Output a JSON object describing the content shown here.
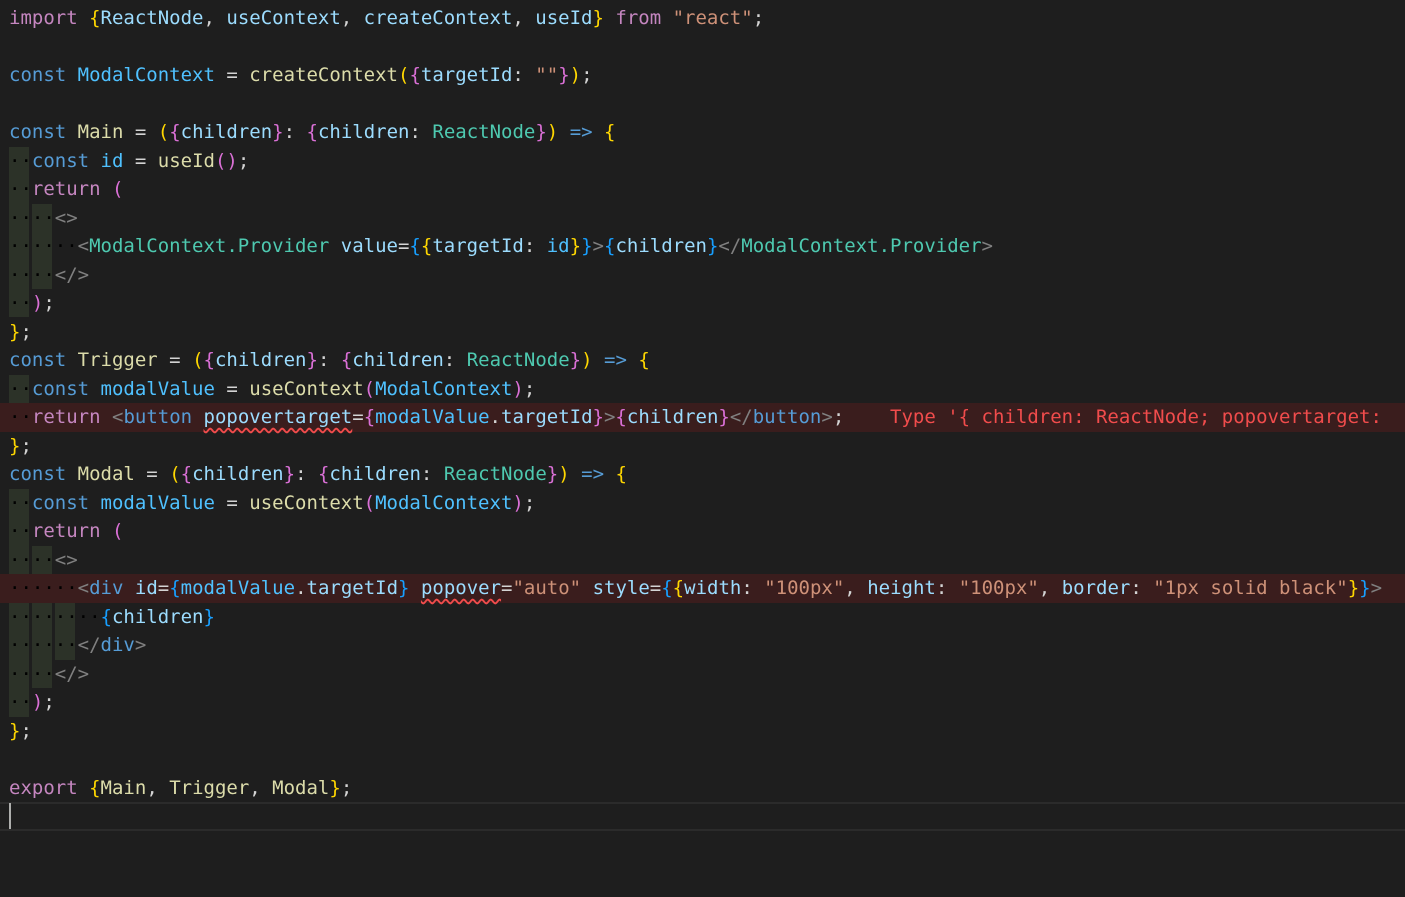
{
  "editor": {
    "language": "tsx",
    "cursor_line": 29,
    "lines": [
      {
        "n": 1,
        "tokens": [
          [
            "import",
            "kw"
          ],
          [
            " ",
            "ws"
          ],
          [
            "{",
            "b1"
          ],
          [
            "ReactNode",
            "var"
          ],
          [
            ", ",
            "punct"
          ],
          [
            "useContext",
            "var"
          ],
          [
            ", ",
            "punct"
          ],
          [
            "createContext",
            "var"
          ],
          [
            ", ",
            "punct"
          ],
          [
            "useId",
            "var"
          ],
          [
            "}",
            "b1"
          ],
          [
            " ",
            "ws"
          ],
          [
            "from",
            "kw"
          ],
          [
            " ",
            "ws"
          ],
          [
            "\"react\"",
            "str"
          ],
          [
            ";",
            "punct"
          ]
        ]
      },
      {
        "n": 2,
        "tokens": []
      },
      {
        "n": 3,
        "tokens": [
          [
            "const",
            "sk"
          ],
          [
            " ",
            "ws"
          ],
          [
            "ModalContext",
            "const"
          ],
          [
            " = ",
            "punct"
          ],
          [
            "createContext",
            "fn"
          ],
          [
            "(",
            "b1"
          ],
          [
            "{",
            "b2"
          ],
          [
            "targetId",
            "var"
          ],
          [
            ": ",
            "punct"
          ],
          [
            "\"\"",
            "str"
          ],
          [
            "}",
            "b2"
          ],
          [
            ")",
            "b1"
          ],
          [
            ";",
            "punct"
          ]
        ]
      },
      {
        "n": 4,
        "tokens": []
      },
      {
        "n": 5,
        "tokens": [
          [
            "const",
            "sk"
          ],
          [
            " ",
            "ws"
          ],
          [
            "Main",
            "fn"
          ],
          [
            " = ",
            "punct"
          ],
          [
            "(",
            "b1"
          ],
          [
            "{",
            "b2"
          ],
          [
            "children",
            "var"
          ],
          [
            "}",
            "b2"
          ],
          [
            ": ",
            "punct"
          ],
          [
            "{",
            "b2"
          ],
          [
            "children",
            "var"
          ],
          [
            ": ",
            "punct"
          ],
          [
            "ReactNode",
            "type"
          ],
          [
            "}",
            "b2"
          ],
          [
            ")",
            "b1"
          ],
          [
            " ",
            "ws"
          ],
          [
            "=>",
            "sk"
          ],
          [
            " ",
            "ws"
          ],
          [
            "{",
            "b1"
          ]
        ]
      },
      {
        "n": 6,
        "tokens": [
          [
            "··",
            "ws"
          ],
          [
            "const",
            "sk"
          ],
          [
            " ",
            "ws"
          ],
          [
            "id",
            "const"
          ],
          [
            " = ",
            "punct"
          ],
          [
            "useId",
            "fn"
          ],
          [
            "()",
            "b2"
          ],
          [
            ";",
            "punct"
          ]
        ]
      },
      {
        "n": 7,
        "tokens": [
          [
            "··",
            "ws"
          ],
          [
            "return",
            "kw"
          ],
          [
            " ",
            "ws"
          ],
          [
            "(",
            "b2"
          ]
        ]
      },
      {
        "n": 8,
        "tokens": [
          [
            "····",
            "ws"
          ],
          [
            "<>",
            "tag"
          ]
        ]
      },
      {
        "n": 9,
        "tokens": [
          [
            "······",
            "ws"
          ],
          [
            "<",
            "tag"
          ],
          [
            "ModalContext.Provider",
            "type"
          ],
          [
            " ",
            "ws"
          ],
          [
            "value",
            "var"
          ],
          [
            "=",
            "punct"
          ],
          [
            "{",
            "b3"
          ],
          [
            "{",
            "b1"
          ],
          [
            "targetId",
            "var"
          ],
          [
            ": ",
            "punct"
          ],
          [
            "id",
            "const"
          ],
          [
            "}",
            "b1"
          ],
          [
            "}",
            "b3"
          ],
          [
            ">",
            "tag"
          ],
          [
            "{",
            "b3"
          ],
          [
            "children",
            "var"
          ],
          [
            "}",
            "b3"
          ],
          [
            "</",
            "tag"
          ],
          [
            "ModalContext.Provider",
            "type"
          ],
          [
            ">",
            "tag"
          ]
        ]
      },
      {
        "n": 10,
        "tokens": [
          [
            "····",
            "ws"
          ],
          [
            "</>",
            "tag"
          ]
        ]
      },
      {
        "n": 11,
        "tokens": [
          [
            "··",
            "ws"
          ],
          [
            ")",
            "b2"
          ],
          [
            ";",
            "punct"
          ]
        ]
      },
      {
        "n": 12,
        "tokens": [
          [
            "}",
            "b1"
          ],
          [
            ";",
            "punct"
          ]
        ]
      },
      {
        "n": 13,
        "tokens": [
          [
            "const",
            "sk"
          ],
          [
            " ",
            "ws"
          ],
          [
            "Trigger",
            "fn"
          ],
          [
            " = ",
            "punct"
          ],
          [
            "(",
            "b1"
          ],
          [
            "{",
            "b2"
          ],
          [
            "children",
            "var"
          ],
          [
            "}",
            "b2"
          ],
          [
            ": ",
            "punct"
          ],
          [
            "{",
            "b2"
          ],
          [
            "children",
            "var"
          ],
          [
            ": ",
            "punct"
          ],
          [
            "ReactNode",
            "type"
          ],
          [
            "}",
            "b2"
          ],
          [
            ")",
            "b1"
          ],
          [
            " ",
            "ws"
          ],
          [
            "=>",
            "sk"
          ],
          [
            " ",
            "ws"
          ],
          [
            "{",
            "b1"
          ]
        ]
      },
      {
        "n": 14,
        "tokens": [
          [
            "··",
            "ws"
          ],
          [
            "const",
            "sk"
          ],
          [
            " ",
            "ws"
          ],
          [
            "modalValue",
            "const"
          ],
          [
            " = ",
            "punct"
          ],
          [
            "useContext",
            "fn"
          ],
          [
            "(",
            "b2"
          ],
          [
            "ModalContext",
            "const"
          ],
          [
            ")",
            "b2"
          ],
          [
            ";",
            "punct"
          ]
        ]
      },
      {
        "n": 15,
        "error": true,
        "tokens": [
          [
            "··",
            "ws"
          ],
          [
            "return",
            "kw"
          ],
          [
            " ",
            "ws"
          ],
          [
            "<",
            "tag"
          ],
          [
            "button",
            "sk"
          ],
          [
            " ",
            "ws"
          ],
          [
            "popovertarget",
            "var",
            "sq"
          ],
          [
            "=",
            "punct"
          ],
          [
            "{",
            "b2"
          ],
          [
            "modalValue",
            "const"
          ],
          [
            ".",
            "punct"
          ],
          [
            "targetId",
            "var"
          ],
          [
            "}",
            "b2"
          ],
          [
            ">",
            "tag"
          ],
          [
            "{",
            "b2"
          ],
          [
            "children",
            "var"
          ],
          [
            "}",
            "b2"
          ],
          [
            "</",
            "tag"
          ],
          [
            "button",
            "sk"
          ],
          [
            ">",
            "tag"
          ],
          [
            ";",
            "punct"
          ],
          [
            "    ",
            "ws"
          ],
          [
            "Type '{ children: ReactNode; popovertarget:",
            "errmsg"
          ]
        ]
      },
      {
        "n": 16,
        "tokens": [
          [
            "}",
            "b1"
          ],
          [
            ";",
            "punct"
          ]
        ]
      },
      {
        "n": 17,
        "tokens": [
          [
            "const",
            "sk"
          ],
          [
            " ",
            "ws"
          ],
          [
            "Modal",
            "fn"
          ],
          [
            " = ",
            "punct"
          ],
          [
            "(",
            "b1"
          ],
          [
            "{",
            "b2"
          ],
          [
            "children",
            "var"
          ],
          [
            "}",
            "b2"
          ],
          [
            ": ",
            "punct"
          ],
          [
            "{",
            "b2"
          ],
          [
            "children",
            "var"
          ],
          [
            ": ",
            "punct"
          ],
          [
            "ReactNode",
            "type"
          ],
          [
            "}",
            "b2"
          ],
          [
            ")",
            "b1"
          ],
          [
            " ",
            "ws"
          ],
          [
            "=>",
            "sk"
          ],
          [
            " ",
            "ws"
          ],
          [
            "{",
            "b1"
          ]
        ]
      },
      {
        "n": 18,
        "tokens": [
          [
            "··",
            "ws"
          ],
          [
            "const",
            "sk"
          ],
          [
            " ",
            "ws"
          ],
          [
            "modalValue",
            "const"
          ],
          [
            " = ",
            "punct"
          ],
          [
            "useContext",
            "fn"
          ],
          [
            "(",
            "b2"
          ],
          [
            "ModalContext",
            "const"
          ],
          [
            ")",
            "b2"
          ],
          [
            ";",
            "punct"
          ]
        ]
      },
      {
        "n": 19,
        "tokens": [
          [
            "··",
            "ws"
          ],
          [
            "return",
            "kw"
          ],
          [
            " ",
            "ws"
          ],
          [
            "(",
            "b2"
          ]
        ]
      },
      {
        "n": 20,
        "tokens": [
          [
            "····",
            "ws"
          ],
          [
            "<>",
            "tag"
          ]
        ]
      },
      {
        "n": 21,
        "error": true,
        "tokens": [
          [
            "······",
            "ws"
          ],
          [
            "<",
            "tag"
          ],
          [
            "div",
            "sk"
          ],
          [
            " ",
            "ws"
          ],
          [
            "id",
            "var"
          ],
          [
            "=",
            "punct"
          ],
          [
            "{",
            "b3"
          ],
          [
            "modalValue",
            "const"
          ],
          [
            ".",
            "punct"
          ],
          [
            "targetId",
            "var"
          ],
          [
            "}",
            "b3"
          ],
          [
            " ",
            "ws"
          ],
          [
            "popover",
            "var",
            "sq"
          ],
          [
            "=",
            "punct"
          ],
          [
            "\"auto\"",
            "str"
          ],
          [
            " ",
            "ws"
          ],
          [
            "style",
            "var"
          ],
          [
            "=",
            "punct"
          ],
          [
            "{",
            "b3"
          ],
          [
            "{",
            "b1"
          ],
          [
            "width",
            "var"
          ],
          [
            ": ",
            "punct"
          ],
          [
            "\"100px\"",
            "str"
          ],
          [
            ", ",
            "punct"
          ],
          [
            "height",
            "var"
          ],
          [
            ": ",
            "punct"
          ],
          [
            "\"100px\"",
            "str"
          ],
          [
            ", ",
            "punct"
          ],
          [
            "border",
            "var"
          ],
          [
            ": ",
            "punct"
          ],
          [
            "\"1px solid black\"",
            "str"
          ],
          [
            "}",
            "b1"
          ],
          [
            "}",
            "b3"
          ],
          [
            ">",
            "tag"
          ]
        ]
      },
      {
        "n": 22,
        "tokens": [
          [
            "········",
            "ws"
          ],
          [
            "{",
            "b3"
          ],
          [
            "children",
            "var"
          ],
          [
            "}",
            "b3"
          ]
        ]
      },
      {
        "n": 23,
        "tokens": [
          [
            "······",
            "ws"
          ],
          [
            "</",
            "tag"
          ],
          [
            "div",
            "sk"
          ],
          [
            ">",
            "tag"
          ]
        ]
      },
      {
        "n": 24,
        "tokens": [
          [
            "····",
            "ws"
          ],
          [
            "</>",
            "tag"
          ]
        ]
      },
      {
        "n": 25,
        "tokens": [
          [
            "··",
            "ws"
          ],
          [
            ")",
            "b2"
          ],
          [
            ";",
            "punct"
          ]
        ]
      },
      {
        "n": 26,
        "tokens": [
          [
            "}",
            "b1"
          ],
          [
            ";",
            "punct"
          ]
        ]
      },
      {
        "n": 27,
        "tokens": []
      },
      {
        "n": 28,
        "tokens": [
          [
            "export",
            "kw"
          ],
          [
            " ",
            "ws"
          ],
          [
            "{",
            "b1"
          ],
          [
            "Main",
            "fn"
          ],
          [
            ", ",
            "punct"
          ],
          [
            "Trigger",
            "fn"
          ],
          [
            ", ",
            "punct"
          ],
          [
            "Modal",
            "fn"
          ],
          [
            "}",
            "b1"
          ],
          [
            ";",
            "punct"
          ]
        ]
      },
      {
        "n": 29,
        "tokens": []
      }
    ]
  }
}
